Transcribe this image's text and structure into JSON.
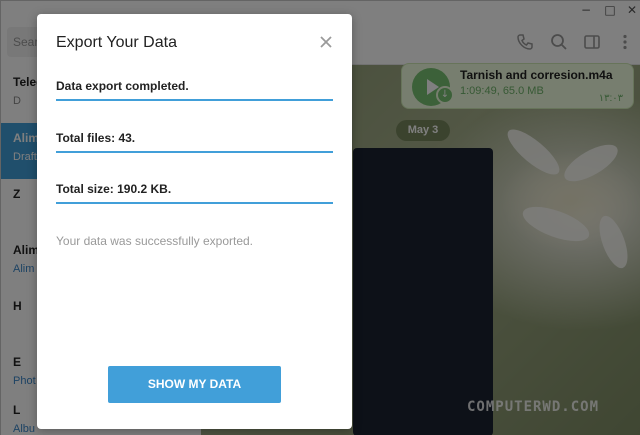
{
  "window": {
    "controls": [
      "−",
      "□",
      "✕"
    ]
  },
  "sidebar": {
    "search_placeholder": "Search",
    "chats": [
      {
        "name": "Teleg",
        "sub": "D"
      },
      {
        "name": "Alim",
        "sub": "Draft"
      },
      {
        "name": "Z",
        "sub": ""
      },
      {
        "name": "Alim",
        "sub": "Alim"
      },
      {
        "name": "H",
        "sub": ""
      },
      {
        "name": "E",
        "sub": "Phot"
      },
      {
        "name": "L",
        "sub": "Albu"
      }
    ]
  },
  "chat": {
    "header_icons": [
      "phone-icon",
      "search-icon",
      "sidebar-toggle-icon",
      "more-icon"
    ],
    "audio_message": {
      "title": "Tarnish and corresion.m4a",
      "meta": "1:09:49, 65.0 MB",
      "time": "١٣:٠٣"
    },
    "date_label": "May 3",
    "watermark": "COMPUTERWD.COM"
  },
  "dialog": {
    "title": "Export Your Data",
    "status": "Data export completed.",
    "total_files": "Total files: 43.",
    "total_size": "Total size: 190.2 KB.",
    "note": "Your data was successfully exported.",
    "button_label": "SHOW MY DATA"
  },
  "colors": {
    "accent": "#419fd9",
    "bubble": "#effdde",
    "audio_green": "#78c272"
  }
}
